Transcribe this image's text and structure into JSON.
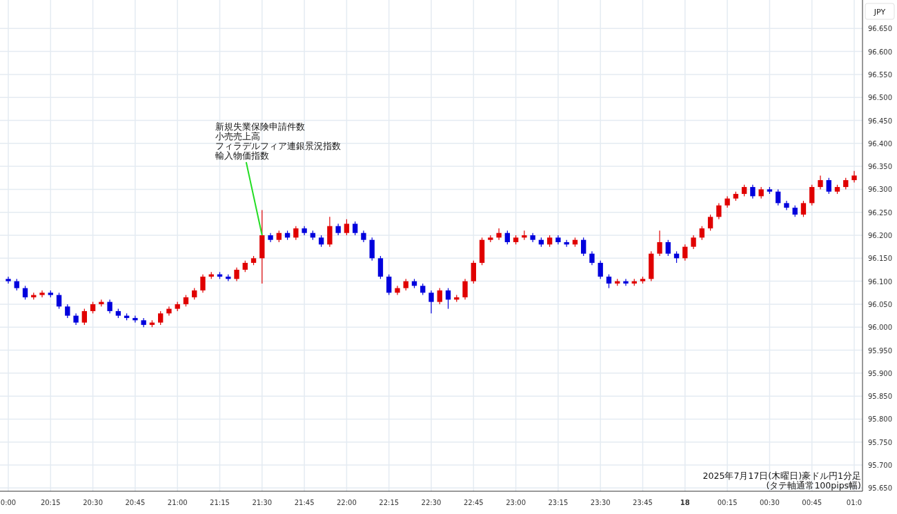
{
  "chart": {
    "chart_data": {
      "type": "candlestick",
      "title": "2025年7月17日(木曜日)豪ドル円1分足",
      "subtitle": "(タテ軸通常100pips幅)",
      "ylabel": "JPY",
      "categories": [
        "0:00",
        null,
        null,
        null,
        null,
        "20:15",
        null,
        null,
        null,
        null,
        "20:30",
        null,
        null,
        null,
        null,
        "20:45",
        null,
        null,
        null,
        null,
        "21:00",
        null,
        null,
        null,
        null,
        "21:15",
        null,
        null,
        null,
        null,
        "21:30",
        null,
        null,
        null,
        null,
        "21:45",
        null,
        null,
        null,
        null,
        "22:00",
        null,
        null,
        null,
        null,
        "22:15",
        null,
        null,
        null,
        null,
        "22:30",
        null,
        null,
        null,
        null,
        "22:45",
        null,
        null,
        null,
        null,
        "23:00",
        null,
        null,
        null,
        null,
        "23:15",
        null,
        null,
        null,
        null,
        "23:30",
        null,
        null,
        null,
        null,
        "23:45",
        null,
        null,
        null,
        null,
        "18",
        null,
        null,
        null,
        null,
        "00:15",
        null,
        null,
        null,
        null,
        "00:30",
        null,
        null,
        null,
        null,
        "00:45",
        null,
        null,
        null,
        null,
        "01:0"
      ],
      "ohlc": [
        [
          96.105,
          96.11,
          96.095,
          96.1
        ],
        [
          96.1,
          96.105,
          96.08,
          96.085
        ],
        [
          96.085,
          96.09,
          96.06,
          96.065
        ],
        [
          96.065,
          96.075,
          96.06,
          96.07
        ],
        [
          96.07,
          96.08,
          96.065,
          96.075
        ],
        [
          96.075,
          96.08,
          96.065,
          96.07
        ],
        [
          96.07,
          96.075,
          96.04,
          96.045
        ],
        [
          96.045,
          96.05,
          96.02,
          96.025
        ],
        [
          96.025,
          96.03,
          96.005,
          96.01
        ],
        [
          96.01,
          96.04,
          96.005,
          96.035
        ],
        [
          96.035,
          96.055,
          96.03,
          96.05
        ],
        [
          96.05,
          96.06,
          96.045,
          96.055
        ],
        [
          96.055,
          96.06,
          96.03,
          96.035
        ],
        [
          96.035,
          96.04,
          96.02,
          96.025
        ],
        [
          96.025,
          96.03,
          96.015,
          96.02
        ],
        [
          96.02,
          96.025,
          96.01,
          96.015
        ],
        [
          96.015,
          96.02,
          96.0,
          96.005
        ],
        [
          96.005,
          96.015,
          96.0,
          96.01
        ],
        [
          96.01,
          96.035,
          96.005,
          96.03
        ],
        [
          96.03,
          96.045,
          96.025,
          96.04
        ],
        [
          96.04,
          96.055,
          96.035,
          96.05
        ],
        [
          96.05,
          96.07,
          96.045,
          96.065
        ],
        [
          96.065,
          96.085,
          96.06,
          96.08
        ],
        [
          96.08,
          96.115,
          96.075,
          96.11
        ],
        [
          96.11,
          96.12,
          96.105,
          96.115
        ],
        [
          96.115,
          96.12,
          96.105,
          96.11
        ],
        [
          96.11,
          96.115,
          96.1,
          96.105
        ],
        [
          96.105,
          96.13,
          96.1,
          96.125
        ],
        [
          96.125,
          96.145,
          96.12,
          96.14
        ],
        [
          96.14,
          96.155,
          96.135,
          96.15
        ],
        [
          96.15,
          96.255,
          96.095,
          96.2
        ],
        [
          96.2,
          96.205,
          96.185,
          96.19
        ],
        [
          96.19,
          96.21,
          96.185,
          96.205
        ],
        [
          96.205,
          96.21,
          96.19,
          96.195
        ],
        [
          96.195,
          96.22,
          96.19,
          96.215
        ],
        [
          96.215,
          96.22,
          96.2,
          96.205
        ],
        [
          96.205,
          96.21,
          96.19,
          96.195
        ],
        [
          96.195,
          96.2,
          96.175,
          96.18
        ],
        [
          96.18,
          96.24,
          96.175,
          96.22
        ],
        [
          96.22,
          96.225,
          96.2,
          96.205
        ],
        [
          96.205,
          96.235,
          96.2,
          96.225
        ],
        [
          96.225,
          96.23,
          96.2,
          96.205
        ],
        [
          96.205,
          96.21,
          96.185,
          96.19
        ],
        [
          96.19,
          96.195,
          96.145,
          96.15
        ],
        [
          96.15,
          96.155,
          96.105,
          96.11
        ],
        [
          96.11,
          96.115,
          96.07,
          96.075
        ],
        [
          96.075,
          96.09,
          96.07,
          96.085
        ],
        [
          96.085,
          96.105,
          96.08,
          96.1
        ],
        [
          96.1,
          96.105,
          96.085,
          96.09
        ],
        [
          96.09,
          96.095,
          96.07,
          96.075
        ],
        [
          96.075,
          96.08,
          96.03,
          96.055
        ],
        [
          96.055,
          96.085,
          96.05,
          96.08
        ],
        [
          96.08,
          96.085,
          96.04,
          96.06
        ],
        [
          96.06,
          96.07,
          96.055,
          96.065
        ],
        [
          96.065,
          96.105,
          96.06,
          96.1
        ],
        [
          96.1,
          96.145,
          96.095,
          96.14
        ],
        [
          96.14,
          96.195,
          96.135,
          96.19
        ],
        [
          96.19,
          96.2,
          96.185,
          96.195
        ],
        [
          96.195,
          96.215,
          96.19,
          96.205
        ],
        [
          96.205,
          96.21,
          96.18,
          96.185
        ],
        [
          96.185,
          96.2,
          96.18,
          96.195
        ],
        [
          96.195,
          96.21,
          96.19,
          96.2
        ],
        [
          96.2,
          96.205,
          96.185,
          96.19
        ],
        [
          96.19,
          96.195,
          96.175,
          96.18
        ],
        [
          96.18,
          96.2,
          96.175,
          96.195
        ],
        [
          96.195,
          96.2,
          96.18,
          96.185
        ],
        [
          96.185,
          96.19,
          96.175,
          96.18
        ],
        [
          96.18,
          96.195,
          96.175,
          96.19
        ],
        [
          96.19,
          96.195,
          96.155,
          96.16
        ],
        [
          96.16,
          96.165,
          96.135,
          96.14
        ],
        [
          96.14,
          96.145,
          96.105,
          96.11
        ],
        [
          96.11,
          96.115,
          96.085,
          96.095
        ],
        [
          96.095,
          96.105,
          96.09,
          96.1
        ],
        [
          96.1,
          96.105,
          96.09,
          96.095
        ],
        [
          96.095,
          96.105,
          96.09,
          96.1
        ],
        [
          96.1,
          96.11,
          96.095,
          96.105
        ],
        [
          96.105,
          96.165,
          96.1,
          96.16
        ],
        [
          96.16,
          96.21,
          96.155,
          96.185
        ],
        [
          96.185,
          96.19,
          96.155,
          96.16
        ],
        [
          96.16,
          96.165,
          96.14,
          96.15
        ],
        [
          96.15,
          96.18,
          96.145,
          96.175
        ],
        [
          96.175,
          96.2,
          96.17,
          96.195
        ],
        [
          96.195,
          96.22,
          96.19,
          96.215
        ],
        [
          96.215,
          96.245,
          96.21,
          96.24
        ],
        [
          96.24,
          96.27,
          96.235,
          96.265
        ],
        [
          96.265,
          96.285,
          96.26,
          96.28
        ],
        [
          96.28,
          96.295,
          96.275,
          96.29
        ],
        [
          96.29,
          96.31,
          96.285,
          96.305
        ],
        [
          96.305,
          96.31,
          96.28,
          96.285
        ],
        [
          96.285,
          96.305,
          96.28,
          96.3
        ],
        [
          96.3,
          96.305,
          96.29,
          96.295
        ],
        [
          96.295,
          96.3,
          96.265,
          96.27
        ],
        [
          96.27,
          96.275,
          96.255,
          96.26
        ],
        [
          96.26,
          96.265,
          96.24,
          96.245
        ],
        [
          96.245,
          96.275,
          96.24,
          96.27
        ],
        [
          96.27,
          96.31,
          96.265,
          96.305
        ],
        [
          96.305,
          96.33,
          96.3,
          96.32
        ],
        [
          96.32,
          96.325,
          96.29,
          96.295
        ],
        [
          96.295,
          96.31,
          96.29,
          96.305
        ],
        [
          96.305,
          96.325,
          96.3,
          96.32
        ],
        [
          96.32,
          96.34,
          96.315,
          96.33
        ]
      ],
      "ylim": [
        95.643,
        96.712
      ],
      "grid": true,
      "yticks": [
        {
          "value": 96.65,
          "label": "96.650"
        },
        {
          "value": 96.6,
          "label": "96.600"
        },
        {
          "value": 96.55,
          "label": "96.550"
        },
        {
          "value": 96.5,
          "label": "96.500"
        },
        {
          "value": 96.45,
          "label": "96.450"
        },
        {
          "value": 96.4,
          "label": "96.400"
        },
        {
          "value": 96.35,
          "label": "96.350"
        },
        {
          "value": 96.3,
          "label": "96.300"
        },
        {
          "value": 96.25,
          "label": "96.250"
        },
        {
          "value": 96.2,
          "label": "96.200"
        },
        {
          "value": 96.15,
          "label": "96.150"
        },
        {
          "value": 96.1,
          "label": "96.100"
        },
        {
          "value": 96.05,
          "label": "96.050"
        },
        {
          "value": 96.0,
          "label": "96.000"
        },
        {
          "value": 95.95,
          "label": "95.950"
        },
        {
          "value": 95.9,
          "label": "95.900"
        },
        {
          "value": 95.85,
          "label": "95.850"
        },
        {
          "value": 95.8,
          "label": "95.800"
        },
        {
          "value": 95.75,
          "label": "95.750"
        },
        {
          "value": 95.7,
          "label": "95.700"
        },
        {
          "value": 95.65,
          "label": "95.650"
        }
      ],
      "annotations": [
        "新規失業保険申請件数",
        "小売売上高",
        "フィラデルフィア連銀景況指数",
        {
          "x": "21:30",
          "y": 96.2,
          "text": "輸入物価指数"
        }
      ]
    }
  }
}
